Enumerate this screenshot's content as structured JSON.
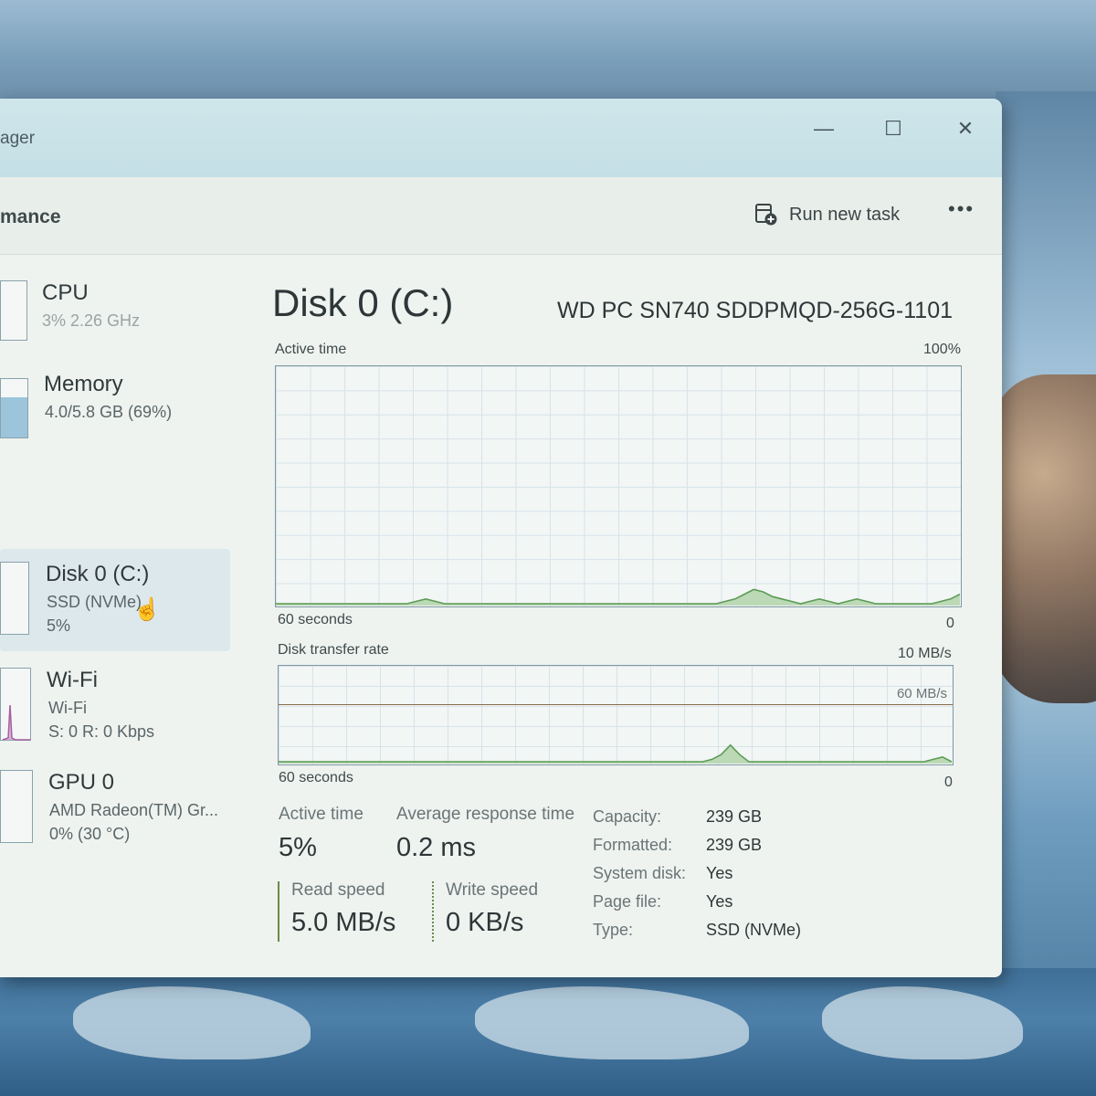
{
  "window": {
    "title": "ager",
    "minimize_glyph": "—",
    "maximize_glyph": "☐",
    "close_glyph": "✕"
  },
  "header": {
    "page_title": "mance",
    "run_new_task_label": "Run new task",
    "run_new_task_icon": "run-task-icon",
    "more_label": "•••"
  },
  "sidebar": {
    "items": [
      {
        "title": "CPU",
        "line1": "3% 2.26 GHz",
        "line2": ""
      },
      {
        "title": "Memory",
        "line1": "4.0/5.8 GB (69%)",
        "line2": ""
      },
      {
        "title": "Disk 0 (C:)",
        "line1": "SSD (NVMe)",
        "line2": "5%"
      },
      {
        "title": "Wi-Fi",
        "line1": "Wi-Fi",
        "line2": "S: 0 R: 0 Kbps"
      },
      {
        "title": "GPU 0",
        "line1": "AMD Radeon(TM) Gr...",
        "line2": "0% (30 °C)"
      }
    ],
    "selected_index": 2,
    "memory_fill_fraction": 0.69
  },
  "disk": {
    "title": "Disk 0 (C:)",
    "model": "WD PC SN740 SDDPMQD-256G-1101",
    "active_graph": {
      "label": "Active time",
      "max_label": "100%",
      "time_label": "60 seconds",
      "min_label": "0",
      "series": [
        0,
        0,
        0,
        0,
        0,
        0,
        0,
        0,
        0,
        0,
        0,
        0,
        0,
        0,
        0,
        1,
        2,
        1,
        0,
        0,
        0,
        0,
        0,
        0,
        0,
        0,
        0,
        0,
        0,
        0,
        0,
        0,
        0,
        0,
        0,
        0,
        0,
        0,
        0,
        0,
        0,
        0,
        0,
        0,
        0,
        0,
        0,
        0,
        1,
        2,
        4,
        6,
        5,
        3,
        2,
        1,
        0,
        1,
        2,
        1,
        0,
        1,
        2,
        1,
        0,
        0,
        0,
        0,
        0,
        0,
        0,
        1,
        2,
        4
      ]
    },
    "transfer_graph": {
      "label": "Disk transfer rate",
      "max_label": "10 MB/s",
      "line_label": "60 MB/s",
      "time_label": "60 seconds",
      "min_label": "0",
      "series": [
        0,
        0,
        0,
        0,
        0,
        0,
        0,
        0,
        0,
        0,
        0,
        0,
        0,
        0,
        0,
        0,
        0,
        0,
        0,
        0,
        0,
        0,
        0,
        0,
        0,
        0,
        0,
        0,
        0,
        0,
        0,
        0,
        0,
        0,
        0,
        0,
        0,
        0,
        0,
        0,
        0,
        0,
        0,
        0,
        0,
        0,
        0,
        1,
        3,
        7,
        3,
        0,
        0,
        0,
        0,
        0,
        0,
        0,
        0,
        0,
        0,
        0,
        0,
        0,
        0,
        0,
        0,
        0,
        0,
        0,
        0,
        1,
        2,
        0
      ]
    },
    "stats": {
      "active_time_label": "Active time",
      "active_time_value": "5%",
      "avg_response_label": "Average response time",
      "avg_response_value": "0.2 ms",
      "read_speed_label": "Read speed",
      "read_speed_value": "5.0 MB/s",
      "write_speed_label": "Write speed",
      "write_speed_value": "0 KB/s"
    },
    "info": [
      {
        "key": "Capacity:",
        "value": "239 GB"
      },
      {
        "key": "Formatted:",
        "value": "239 GB"
      },
      {
        "key": "System disk:",
        "value": "Yes"
      },
      {
        "key": "Page file:",
        "value": "Yes"
      },
      {
        "key": "Type:",
        "value": "SSD (NVMe)"
      }
    ]
  },
  "colors": {
    "disk_accent": "#5c9b55",
    "disk_fill": "#bcd9b6",
    "wifi_accent": "#a55fa0",
    "memory_fill": "#9cc5dc"
  }
}
